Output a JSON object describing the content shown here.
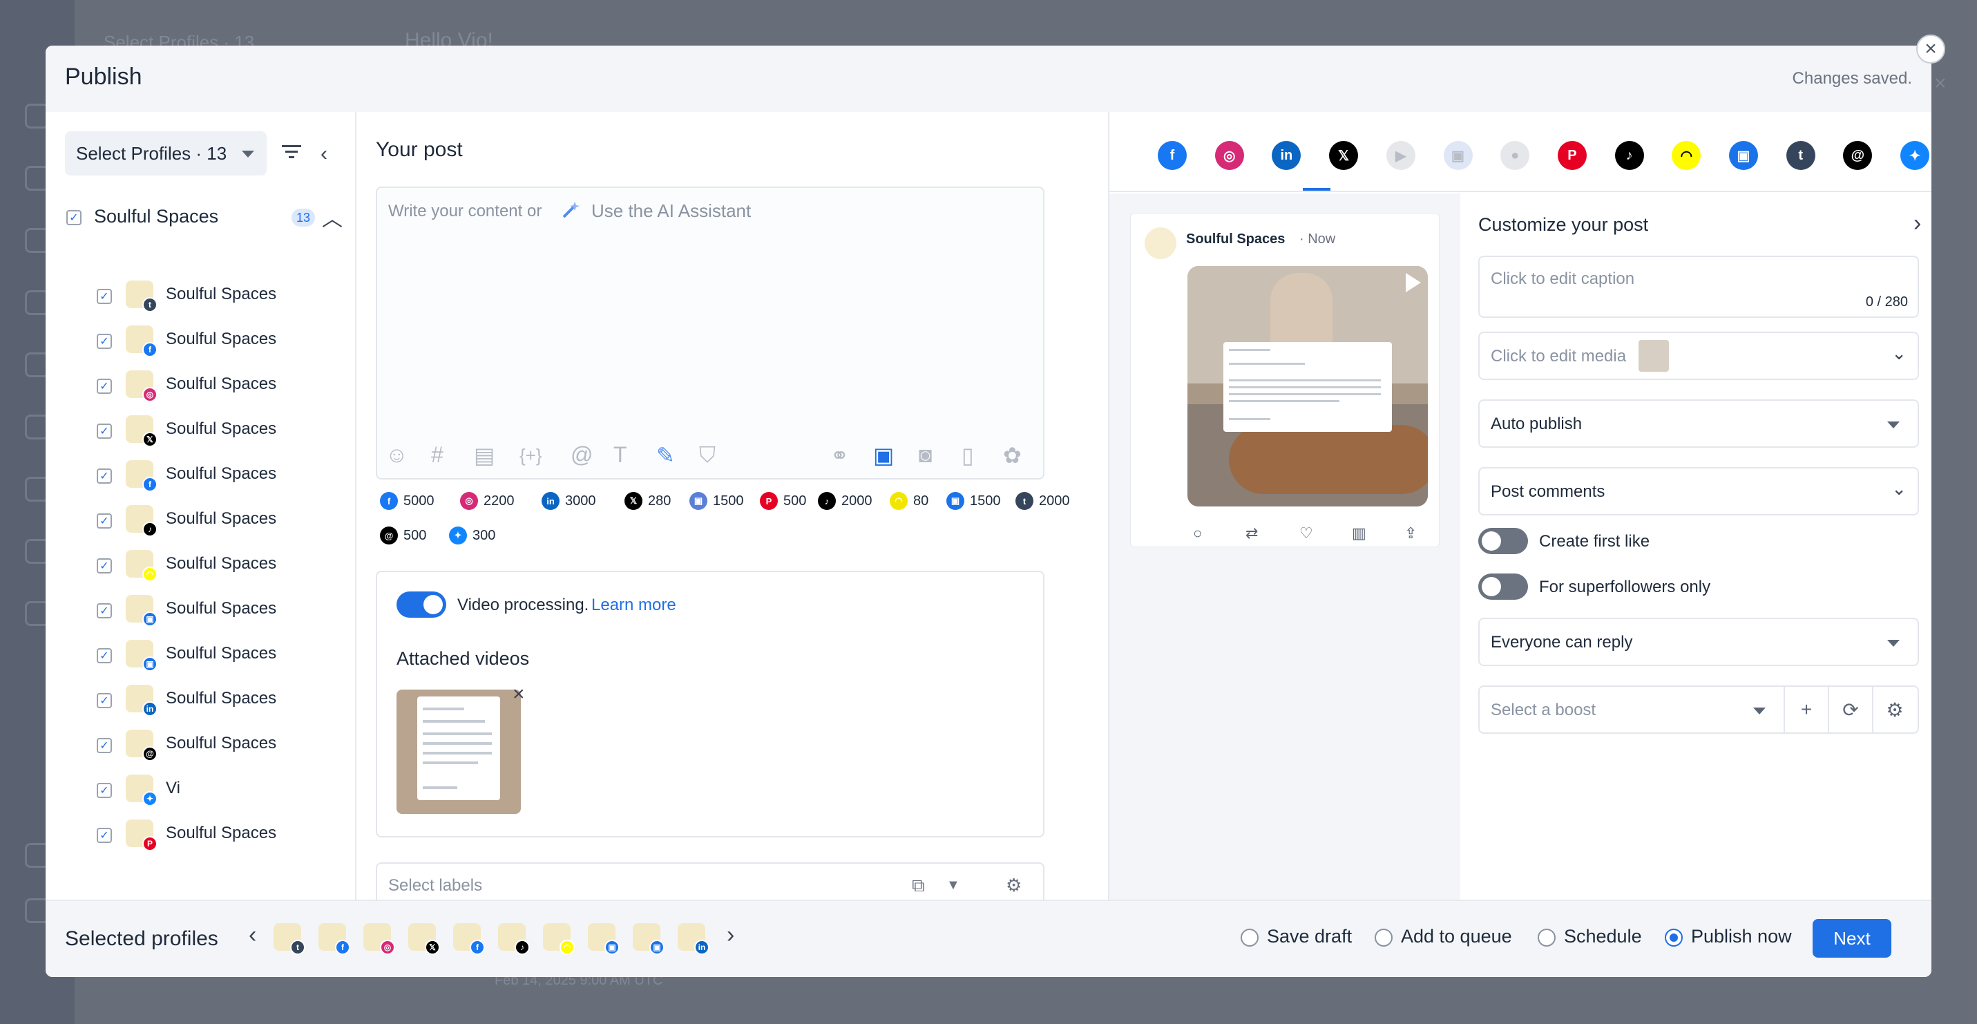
{
  "background": {
    "header_title": "Select Profiles · 13",
    "header_greeting": "Hello Vio!",
    "footer_time": "Feb 14, 2025 9:00 AM UTC"
  },
  "modal": {
    "title": "Publish",
    "status": "Changes saved."
  },
  "profiles": {
    "select_label": "Select Profiles · 13",
    "group": {
      "name": "Soulful Spaces",
      "count": "13"
    },
    "items": [
      {
        "name": "Soulful Spaces",
        "network": "tumblr",
        "badge_color": "#35465c",
        "badge_glyph": "t"
      },
      {
        "name": "Soulful Spaces",
        "network": "facebook",
        "badge_color": "#1877f2",
        "badge_glyph": "f"
      },
      {
        "name": "Soulful Spaces",
        "network": "instagram",
        "badge_color": "#d62976",
        "badge_glyph": "◎"
      },
      {
        "name": "Soulful Spaces",
        "network": "x",
        "badge_color": "#000000",
        "badge_glyph": "𝕏"
      },
      {
        "name": "Soulful Spaces",
        "network": "facebook",
        "badge_color": "#1877f2",
        "badge_glyph": "f"
      },
      {
        "name": "Soulful Spaces",
        "network": "tiktok",
        "badge_color": "#000000",
        "badge_glyph": "♪"
      },
      {
        "name": "Soulful Spaces",
        "network": "snapchat",
        "badge_color": "#fffc00",
        "badge_glyph": "◠"
      },
      {
        "name": "Soulful Spaces",
        "network": "google-business",
        "badge_color": "#1a73e8",
        "badge_glyph": "▣"
      },
      {
        "name": "Soulful Spaces",
        "network": "google-business",
        "badge_color": "#1a73e8",
        "badge_glyph": "▣"
      },
      {
        "name": "Soulful Spaces",
        "network": "linkedin",
        "badge_color": "#0a66c2",
        "badge_glyph": "in"
      },
      {
        "name": "Soulful Spaces",
        "network": "threads",
        "badge_color": "#000000",
        "badge_glyph": "@"
      },
      {
        "name": "Vi",
        "network": "bluesky",
        "badge_color": "#1185fe",
        "badge_glyph": "✦"
      },
      {
        "name": "Soulful Spaces",
        "network": "pinterest",
        "badge_color": "#e60023",
        "badge_glyph": "P"
      }
    ]
  },
  "post": {
    "title": "Your post",
    "placeholder": "Write your content or",
    "ai_label": "Use the AI Assistant",
    "limits": [
      {
        "network": "facebook",
        "value": "5000",
        "color": "#1877f2",
        "glyph": "f"
      },
      {
        "network": "instagram",
        "value": "2200",
        "color": "#d62976",
        "glyph": "◎"
      },
      {
        "network": "linkedin",
        "value": "3000",
        "color": "#0a66c2",
        "glyph": "in"
      },
      {
        "network": "x",
        "value": "280",
        "color": "#000000",
        "glyph": "𝕏"
      },
      {
        "network": "google-business",
        "value": "1500",
        "color": "#5a7fd6",
        "glyph": "▣"
      },
      {
        "network": "pinterest",
        "value": "500",
        "color": "#e60023",
        "glyph": "P"
      },
      {
        "network": "tiktok",
        "value": "2000",
        "color": "#000000",
        "glyph": "♪"
      },
      {
        "network": "snapchat",
        "value": "80",
        "color": "#f2e600",
        "glyph": "◠"
      },
      {
        "network": "google-business-2",
        "value": "1500",
        "color": "#1a73e8",
        "glyph": "▣"
      },
      {
        "network": "tumblr",
        "value": "2000",
        "color": "#35465c",
        "glyph": "t"
      },
      {
        "network": "threads",
        "value": "500",
        "color": "#000000",
        "glyph": "@"
      },
      {
        "network": "bluesky",
        "value": "300",
        "color": "#1185fe",
        "glyph": "✦"
      }
    ],
    "video_processing": "Video processing.",
    "learn_more": "Learn more",
    "attached_videos": "Attached videos",
    "labels_placeholder": "Select labels"
  },
  "networks": [
    {
      "name": "facebook",
      "color": "#1877f2",
      "glyph": "f",
      "enabled": true
    },
    {
      "name": "instagram",
      "color": "#d62976",
      "glyph": "◎",
      "enabled": true
    },
    {
      "name": "linkedin",
      "color": "#0a66c2",
      "glyph": "in",
      "enabled": true
    },
    {
      "name": "x",
      "color": "#000000",
      "glyph": "𝕏",
      "enabled": true
    },
    {
      "name": "youtube",
      "color": "#e5e7eb",
      "glyph": "▶",
      "enabled": false
    },
    {
      "name": "google-business",
      "color": "#dfe6f5",
      "glyph": "▣",
      "enabled": false
    },
    {
      "name": "reddit",
      "color": "#e5e7eb",
      "glyph": "●",
      "enabled": false
    },
    {
      "name": "pinterest",
      "color": "#e60023",
      "glyph": "P",
      "enabled": true
    },
    {
      "name": "tiktok",
      "color": "#000000",
      "glyph": "♪",
      "enabled": true
    },
    {
      "name": "snapchat",
      "color": "#fffc00",
      "glyph": "◠",
      "enabled": true
    },
    {
      "name": "google-business-2",
      "color": "#1a73e8",
      "glyph": "▣",
      "enabled": true
    },
    {
      "name": "tumblr",
      "color": "#35465c",
      "glyph": "t",
      "enabled": true
    },
    {
      "name": "threads",
      "color": "#000000",
      "glyph": "@",
      "enabled": true
    },
    {
      "name": "bluesky",
      "color": "#1185fe",
      "glyph": "✦",
      "enabled": true
    }
  ],
  "preview": {
    "name": "Soulful Spaces",
    "time": "· Now"
  },
  "customize": {
    "title": "Customize your post",
    "caption_placeholder": "Click to edit caption",
    "caption_count": "0 / 280",
    "media_placeholder": "Click to edit media",
    "auto_publish": "Auto publish",
    "post_comments": "Post comments",
    "create_first_like": "Create first like",
    "superfollowers": "For superfollowers only",
    "reply": "Everyone can reply",
    "boost_placeholder": "Select a boost"
  },
  "footer": {
    "selected_profiles": "Selected profiles",
    "options": [
      "Save draft",
      "Add to queue",
      "Schedule",
      "Publish now"
    ],
    "selected_option": "Publish now",
    "next": "Next"
  }
}
